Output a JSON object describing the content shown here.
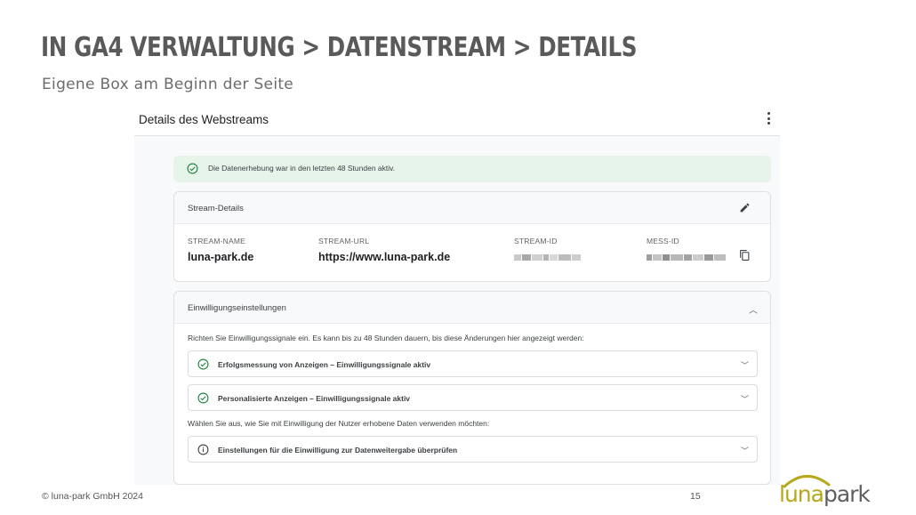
{
  "slide": {
    "title": "In GA4 Verwaltung > Datenstream > Details",
    "subtitle": "Eigene Box am Beginn der Seite",
    "footer": "© luna-park GmbH 2024",
    "page_number": "15",
    "logo": {
      "part1": "luna",
      "part2": "park",
      "accent_color": "#b7a71a"
    }
  },
  "panel": {
    "title": "Details des Webstreams",
    "menu_icon": "more-vert-icon",
    "banner": {
      "icon": "check-circle-icon",
      "text": "Die Datenerhebung war in den letzten 48 Stunden aktiv."
    },
    "stream_details": {
      "heading": "Stream-Details",
      "edit_icon": "pencil-icon",
      "fields": {
        "name_label": "STREAM-NAME",
        "name_value": "luna-park.de",
        "url_label": "STREAM-URL",
        "url_value": "https://www.luna-park.de",
        "id_label": "STREAM-ID",
        "mess_label": "MESS-ID"
      }
    },
    "consent": {
      "heading": "Einwilligungseinstellungen",
      "intro": "Richten Sie Einwilligungssignale ein. Es kann bis zu 48 Stunden dauern, bis diese Änderungen hier angezeigt werden:",
      "rows": [
        {
          "label": "Erfolgsmessung von Anzeigen – Einwilligungssignale aktiv",
          "icon": "check-circle-icon"
        },
        {
          "label": "Personalisierte Anzeigen – Einwilligungssignale aktiv",
          "icon": "check-circle-icon"
        }
      ],
      "intro2": "Wählen Sie aus, wie Sie mit Einwilligung der Nutzer erhobene Daten verwenden möchten:",
      "review_row": {
        "label": "Einstellungen für die Einwilligung zur Datenweitergabe überprüfen",
        "icon": "info-icon"
      }
    }
  },
  "colors": {
    "success_green": "#188038",
    "banner_bg": "#e6f4ea"
  }
}
